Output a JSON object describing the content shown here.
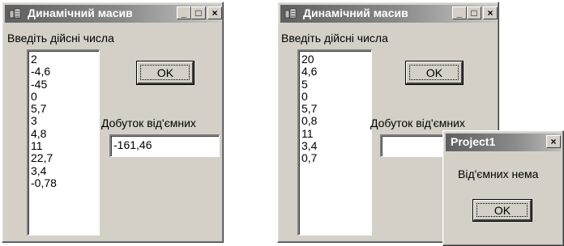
{
  "window_left": {
    "title": "Динамічний масив",
    "caption_buttons": [
      "_",
      "□",
      "×"
    ],
    "prompt_label": "Введіть дійсні числа",
    "list_values": [
      "2",
      "-4,6",
      "-45",
      "0",
      "5,7",
      "3",
      "4,8",
      "11",
      "22,7",
      "3,4",
      "-0,78"
    ],
    "ok_label": "OK",
    "product_label": "Добуток від'ємних",
    "product_value": "-161,46"
  },
  "window_right": {
    "title": "Динамічний масив",
    "caption_buttons": [
      "_",
      "□",
      "×"
    ],
    "prompt_label": "Введіть дійсні числа",
    "list_values": [
      "20",
      "4,6",
      "5",
      "0",
      "5,7",
      "0,8",
      "11",
      "3,4",
      "0,7"
    ],
    "ok_label": "OK",
    "product_label": "Добуток від'ємних",
    "product_value": ""
  },
  "message_box": {
    "title": "Project1",
    "close_glyph": "×",
    "message": "Від'ємних нема",
    "ok_label": "OK"
  },
  "colors": {
    "window_face": "#d4d0c8",
    "title_gradient_start": "#5f5f5f",
    "title_gradient_end": "#c8c8c8"
  },
  "icons": {
    "app_icon": "app-icon",
    "minimize": "minimize-icon",
    "maximize": "maximize-icon",
    "close": "close-icon"
  }
}
